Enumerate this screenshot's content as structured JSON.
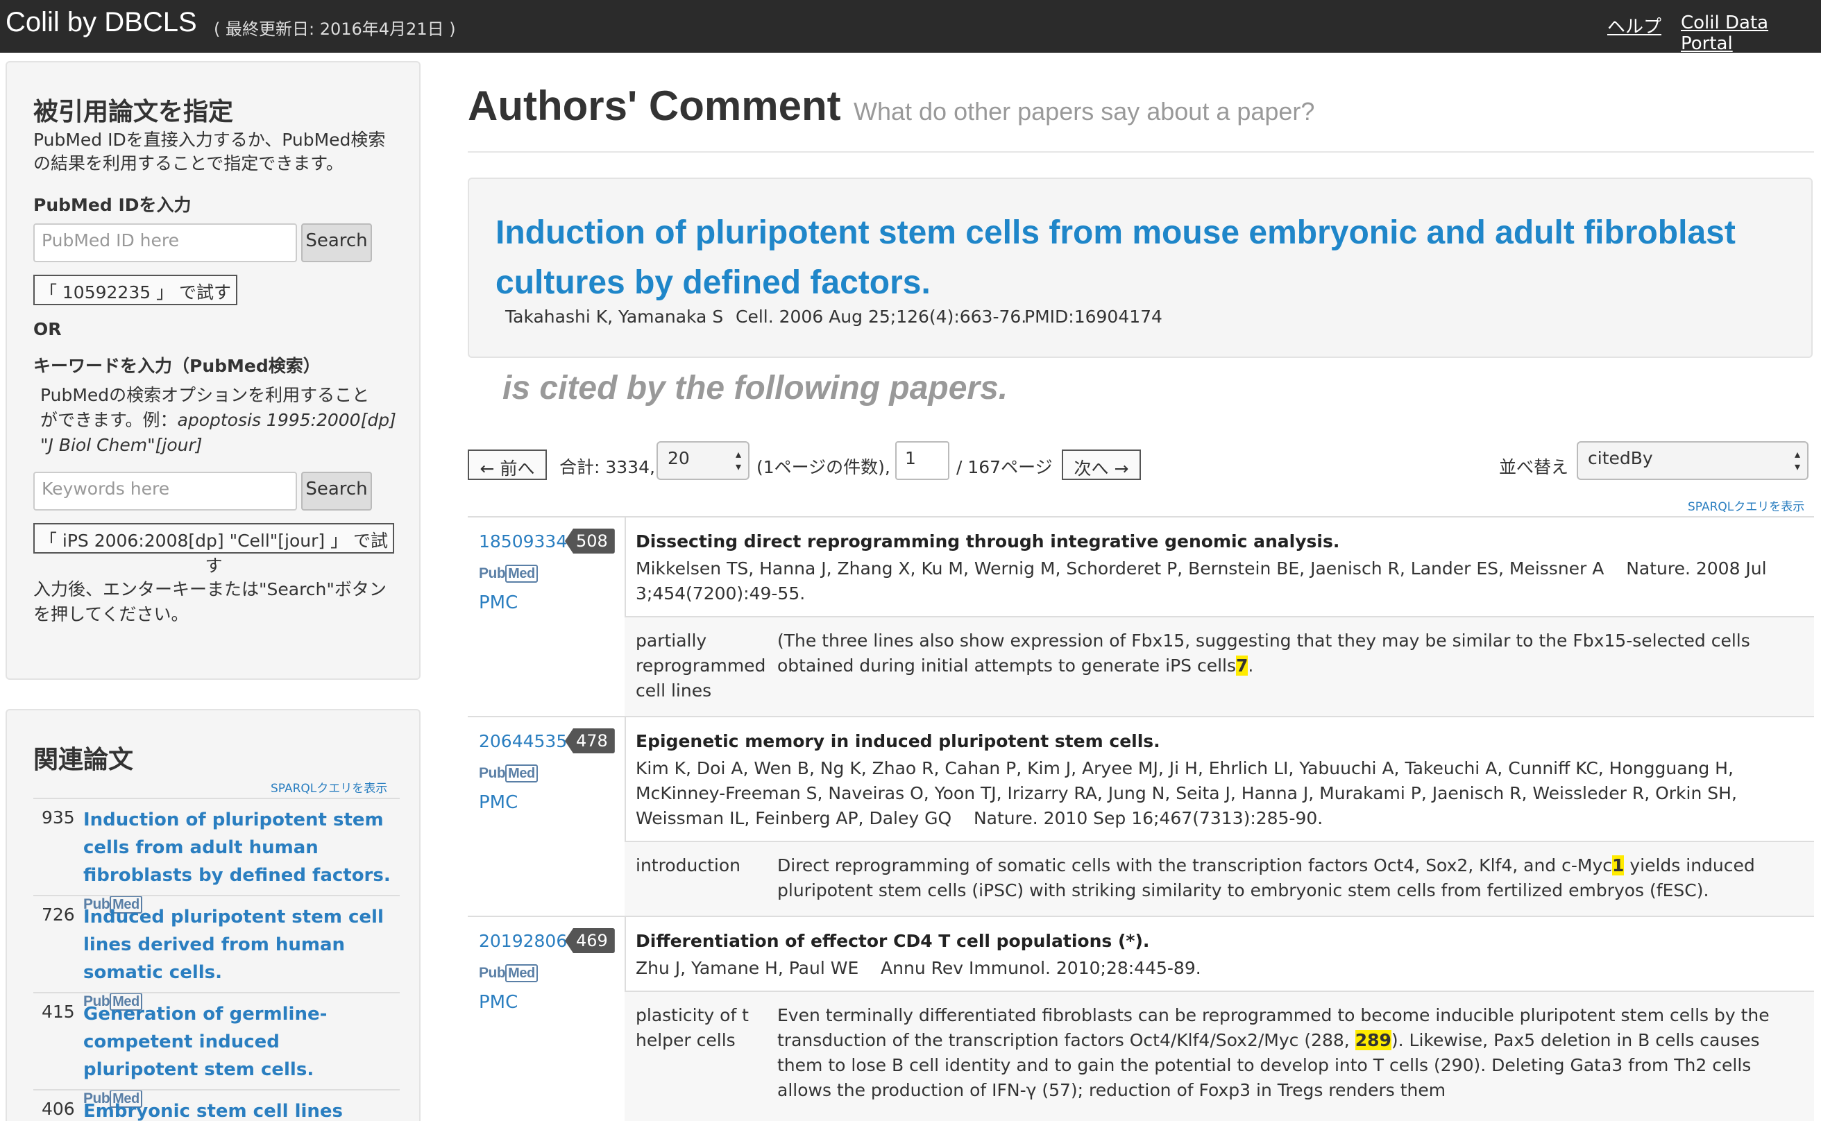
{
  "navbar": {
    "brand": "Colil by DBCLS",
    "updated": "( 最終更新日: 2016年4月21日 )",
    "help": "ヘルプ",
    "portal": "Colil Data Portal"
  },
  "sidebar": {
    "specify_title": "被引用論文を指定",
    "specify_desc_1": "PubMed IDを直接入力するか、PubMed検索",
    "specify_desc_2": "の結果を利用することで指定できます。",
    "pmid_label": "PubMed IDを入力",
    "pmid_placeholder": "PubMed ID here",
    "search_label": "Search",
    "try_pmid": "「 10592235 」 で試す",
    "or_label": "OR",
    "keyword_label": "キーワードを入力（PubMed検索）",
    "keyword_desc_1": "PubMedの検索オプションを利用すること",
    "keyword_desc_2a": "ができます。例：",
    "keyword_desc_2b": "apoptosis 1995:2000[dp]",
    "keyword_desc_3": "\"J Biol Chem\"[jour]",
    "keyword_placeholder": "Keywords here",
    "try_keyword": "「 iPS 2006:2008[dp] \"Cell\"[jour] 」 で試す",
    "hint_1": "入力後、エンターキーまたは\"Search\"ボタン",
    "hint_2": "を押してください。",
    "related_title": "関連論文",
    "sparql": "SPARQLクエリを表示",
    "related": [
      {
        "count": "935",
        "title": "Induction of pluripotent stem cells from adult human fibroblasts by defined factors."
      },
      {
        "count": "726",
        "title": "Induced pluripotent stem cell lines derived from human somatic cells."
      },
      {
        "count": "415",
        "title": "Generation of germline-competent induced pluripotent stem cells."
      },
      {
        "count": "406",
        "title": "Embryonic stem cell lines derived"
      }
    ]
  },
  "main": {
    "title": "Authors' Comment",
    "subtitle": "What do other papers say about a paper?",
    "paper": {
      "title": "Induction of pluripotent stem cells from mouse embryonic and adult fibroblast cultures by defined factors.",
      "authors": "Takahashi K, Yamanaka S",
      "journal": "Cell. 2006 Aug 25;126(4):663-76.",
      "pmid": "PMID:16904174"
    },
    "cited_by": "is cited by the following papers.",
    "pager": {
      "prev": "← 前へ",
      "total": "合計: 3334,",
      "per_page": "20",
      "per_page_label": "(1ページの件数),",
      "page": "1",
      "pages": "/ 167ページ",
      "next": "次へ →",
      "sort_label": "並べ替え",
      "sort_value": "citedBy",
      "sparql": "SPARQLクエリを表示"
    },
    "pubmed_logo_a": "Pub",
    "pubmed_logo_b": "Med",
    "pmc": "PMC",
    "entries": [
      {
        "pmid": "18509334",
        "count": "508",
        "title": "Dissecting direct reprogramming through integrative genomic analysis.",
        "authors": "Mikkelsen TS, Hanna J, Zhang X, Ku M, Wernig M, Schorderet P, Bernstein BE, Jaenisch R, Lander ES, Meissner A",
        "journal": "Nature. 2008 Jul 3;454(7200):49-55.",
        "ctx_label": "partially reprogrammed cell lines",
        "ctx_pre": "(The three lines also show expression of Fbx15, suggesting that they may be similar to the Fbx15-selected cells obtained during initial attempts to generate iPS cells",
        "ctx_hl": "7",
        "ctx_post": "."
      },
      {
        "pmid": "20644535",
        "count": "478",
        "title": "Epigenetic memory in induced pluripotent stem cells.",
        "authors": "Kim K, Doi A, Wen B, Ng K, Zhao R, Cahan P, Kim J, Aryee MJ, Ji H, Ehrlich LI, Yabuuchi A, Takeuchi A, Cunniff KC, Hongguang H, McKinney-Freeman S, Naveiras O, Yoon TJ, Irizarry RA, Jung N, Seita J, Hanna J, Murakami P, Jaenisch R, Weissleder R, Orkin SH, Weissman IL, Feinberg AP, Daley GQ",
        "journal": "Nature. 2010 Sep 16;467(7313):285-90.",
        "ctx_label": "introduction",
        "ctx_pre": "Direct reprogramming of somatic cells with the transcription factors Oct4, Sox2, Klf4, and c-Myc",
        "ctx_hl": "1",
        "ctx_post": " yields induced pluripotent stem cells (iPSC) with striking similarity to embryonic stem cells from fertilized embryos (fESC)."
      },
      {
        "pmid": "20192806",
        "count": "469",
        "title": "Differentiation of effector CD4 T cell populations (*).",
        "authors": "Zhu J, Yamane H, Paul WE",
        "journal": "Annu Rev Immunol. 2010;28:445-89.",
        "ctx_label": "plasticity of t helper cells",
        "ctx_pre": "Even terminally differentiated fibroblasts can be reprogrammed to become inducible pluripotent stem cells by the transduction of the transcription factors Oct4/Klf4/Sox2/Myc (288, ",
        "ctx_hl": "289",
        "ctx_post": "). Likewise, Pax5 deletion in B cells causes them to lose B cell identity and to gain the potential to develop into T cells (290). Deleting Gata3 from Th2 cells allows the production of IFN-γ (57); reduction of Foxp3 in Tregs renders them"
      }
    ]
  }
}
